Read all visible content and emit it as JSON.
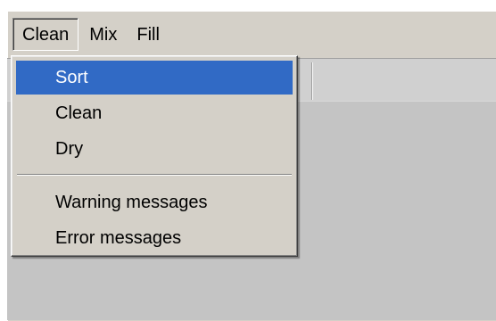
{
  "menubar": {
    "items": [
      {
        "label": "Clean",
        "open": true
      },
      {
        "label": "Mix"
      },
      {
        "label": "Fill"
      }
    ]
  },
  "dropdown": {
    "items": [
      {
        "label": "Sort",
        "selected": true
      },
      {
        "label": "Clean"
      },
      {
        "label": "Dry"
      },
      {
        "label": "Warning messages"
      },
      {
        "label": "Error messages"
      }
    ]
  },
  "colors": {
    "selection": "#316ac5",
    "face": "#d4d0c8",
    "client": "#c4c4c4"
  }
}
